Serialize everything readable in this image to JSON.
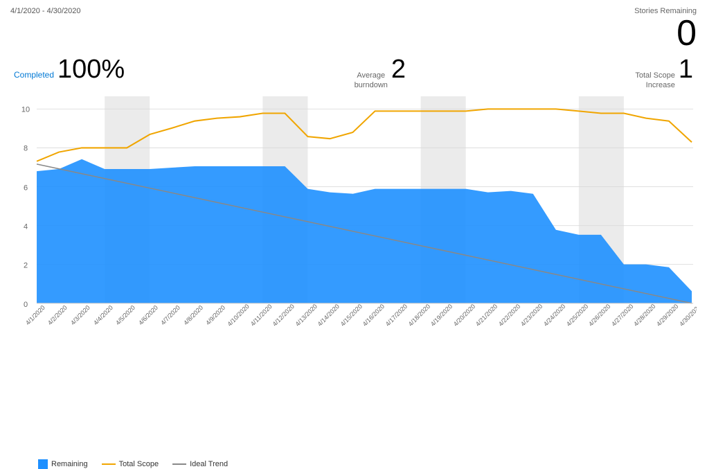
{
  "header": {
    "date_range": "4/1/2020 - 4/30/2020",
    "stories_remaining_label": "Stories Remaining",
    "stories_remaining_value": "0"
  },
  "stats": {
    "completed_label": "Completed",
    "completed_value": "100%",
    "avg_burndown_label1": "Average",
    "avg_burndown_label2": "burndown",
    "avg_burndown_value": "2",
    "total_scope_label1": "Total Scope",
    "total_scope_label2": "Increase",
    "total_scope_value": "1"
  },
  "legend": {
    "remaining_label": "Remaining",
    "total_scope_label": "Total Scope",
    "ideal_trend_label": "Ideal Trend"
  },
  "colors": {
    "remaining_fill": "#1e90ff",
    "total_scope_line": "#f0a500",
    "ideal_trend_line": "#888888",
    "grid_line": "#e0e0e0",
    "weekend_fill": "#d8d8d8"
  }
}
